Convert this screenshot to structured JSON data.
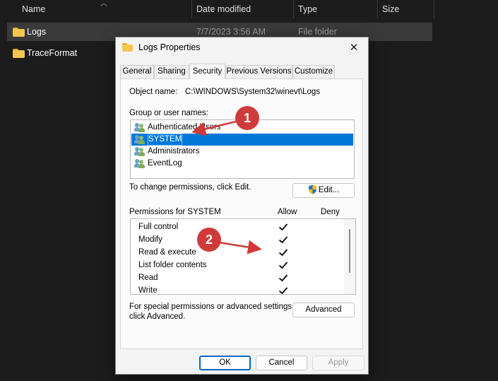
{
  "explorer": {
    "columns": {
      "name": "Name",
      "date": "Date modified",
      "type": "Type",
      "size": "Size"
    },
    "files": [
      {
        "name": "Logs",
        "date": "7/7/2023 3:56 AM",
        "type": "File folder",
        "selected": true,
        "icon": "folder-icon"
      },
      {
        "name": "TraceFormat",
        "date": "",
        "type": "",
        "selected": false,
        "icon": "folder-icon"
      }
    ]
  },
  "dialog": {
    "title": "Logs Properties",
    "close_glyph": "✕",
    "tabs": [
      {
        "label": "General",
        "active": false
      },
      {
        "label": "Sharing",
        "active": false
      },
      {
        "label": "Security",
        "active": true
      },
      {
        "label": "Previous Versions",
        "active": false
      },
      {
        "label": "Customize",
        "active": false
      }
    ],
    "object_name_label": "Object name:",
    "object_name_value": "C:\\WINDOWS\\System32\\winevt\\Logs",
    "group_label": "Group or user names:",
    "groups": [
      {
        "name": "Authenticated Users",
        "selected": false,
        "icon": "users-icon"
      },
      {
        "name": "SYSTEM",
        "selected": true,
        "icon": "users-icon"
      },
      {
        "name": "Administrators",
        "selected": false,
        "icon": "users-icon"
      },
      {
        "name": "EventLog",
        "selected": false,
        "icon": "users-icon"
      }
    ],
    "change_hint": "To change permissions, click Edit.",
    "edit_button": "Edit...",
    "permissions_label": "Permissions for SYSTEM",
    "allow_header": "Allow",
    "deny_header": "Deny",
    "permissions": [
      {
        "name": "Full control",
        "allow": true,
        "deny": false
      },
      {
        "name": "Modify",
        "allow": true,
        "deny": false
      },
      {
        "name": "Read & execute",
        "allow": true,
        "deny": false
      },
      {
        "name": "List folder contents",
        "allow": true,
        "deny": false
      },
      {
        "name": "Read",
        "allow": true,
        "deny": false
      },
      {
        "name": "Write",
        "allow": true,
        "deny": false
      }
    ],
    "special_hint_line1": "For special permissions or advanced settings,",
    "special_hint_line2": "click Advanced.",
    "advanced_button": "Advanced",
    "ok_button": "OK",
    "cancel_button": "Cancel",
    "apply_button": "Apply"
  },
  "annotations": [
    {
      "label": "1",
      "color": "#cf3b3b"
    },
    {
      "label": "2",
      "color": "#cf3b3b"
    }
  ]
}
